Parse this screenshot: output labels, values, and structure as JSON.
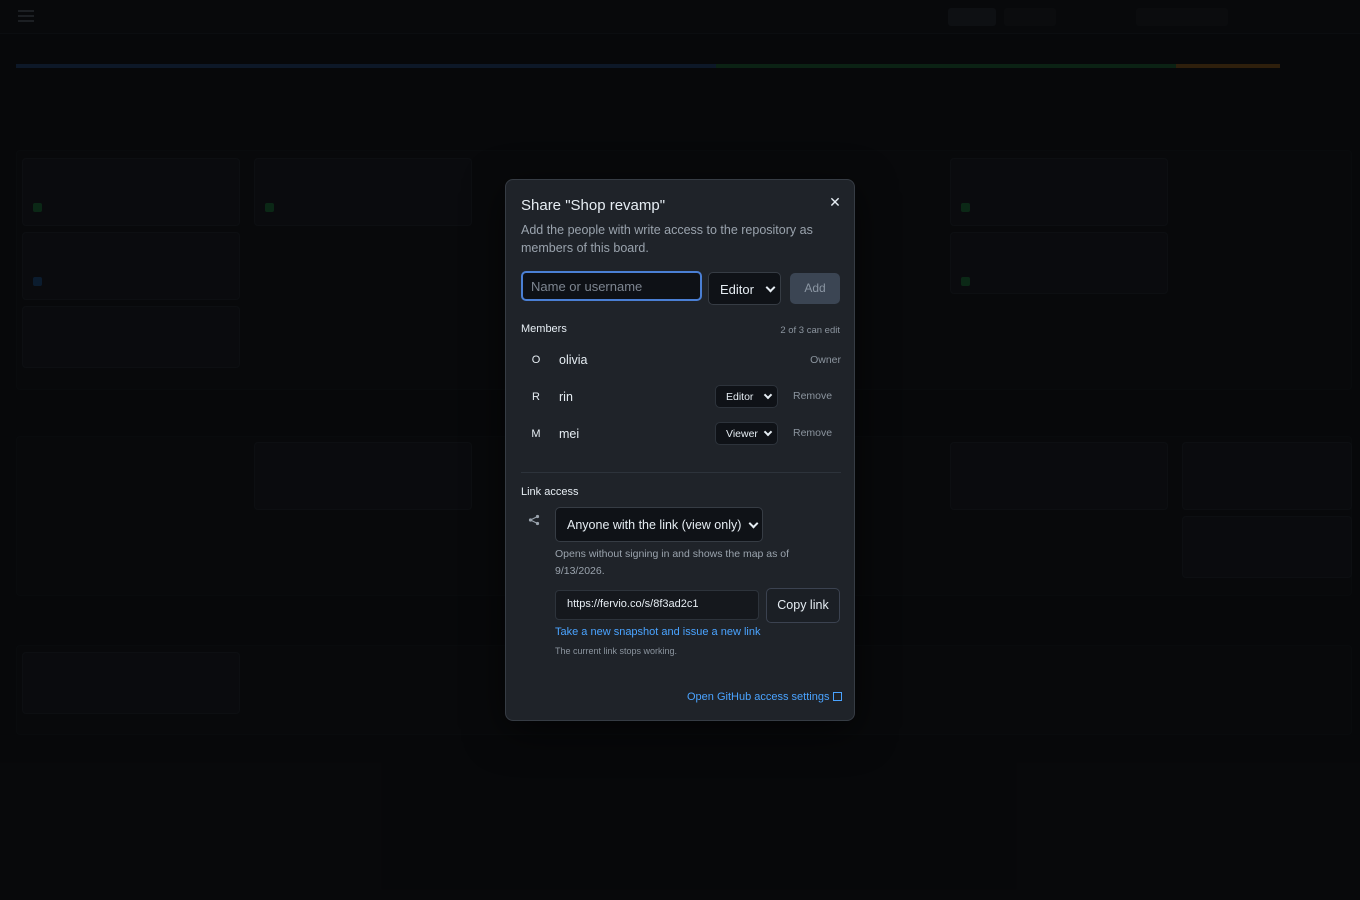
{
  "modal": {
    "title": "Share \"Shop revamp\"",
    "description": "Add the people with write access to the repository as members of this board.",
    "input_placeholder": "Name or username",
    "role_value": "Editor",
    "add_label": "Add",
    "members_heading": "Members",
    "members_count": "2 of 3 can edit",
    "members": [
      {
        "initial": "O",
        "name": "olivia",
        "role": "Owner"
      },
      {
        "initial": "R",
        "name": "rin",
        "role": "Editor",
        "action": "Remove"
      },
      {
        "initial": "M",
        "name": "mei",
        "role": "Viewer",
        "action": "Remove"
      }
    ],
    "link_heading": "Link access",
    "link_option": "Anyone with the link (view only)",
    "link_note": "Opens without signing in and shows the map as of 9/13/2026.",
    "link_url": "https://fervio.co/s/8f3ad2c1",
    "copy_label": "Copy link",
    "snapshot_label": "Take a new snapshot and issue a new link",
    "snapshot_note": "The current link stops working.",
    "github_label": "Open GitHub access settings"
  },
  "colors": {
    "accent": "#4aa3ff",
    "focus_ring": "#4a7fd4",
    "stripe_blue": "#2d5ea8",
    "stripe_green": "#2f8a4e",
    "stripe_orange": "#c9812a"
  }
}
